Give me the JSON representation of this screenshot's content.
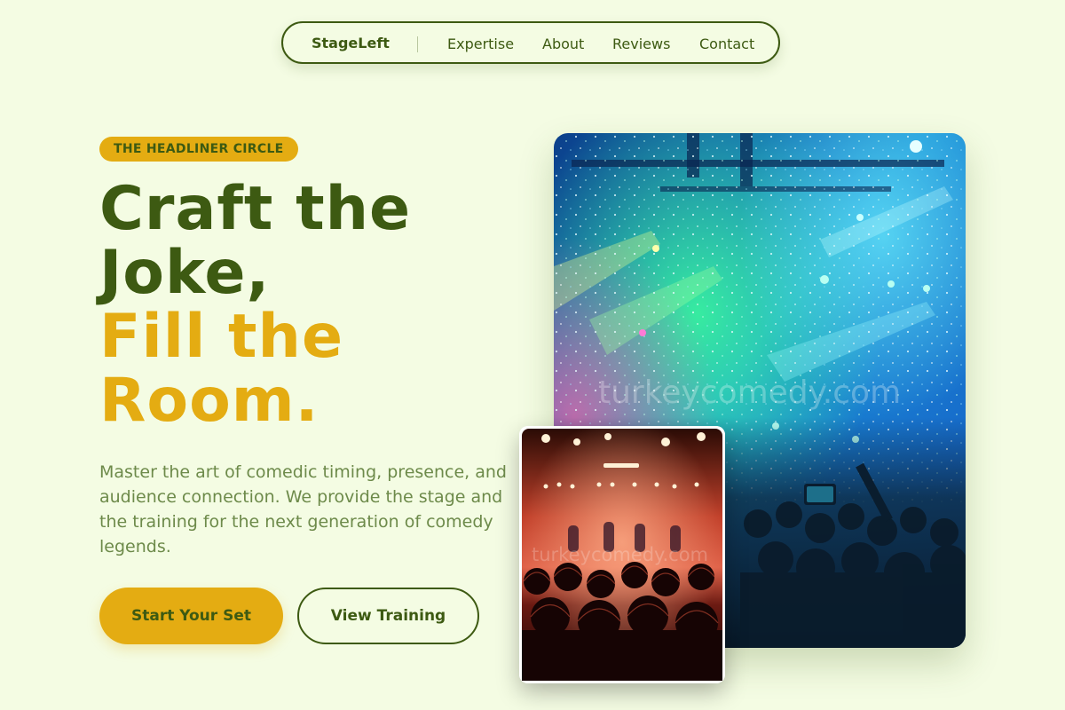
{
  "nav": {
    "brand": "StageLeft",
    "links": [
      "Expertise",
      "About",
      "Reviews",
      "Contact"
    ]
  },
  "hero": {
    "badge": "THE HEADLINER CIRCLE",
    "headline": [
      "Craft the",
      "Joke,",
      "Fill the",
      "Room."
    ],
    "description": "Master the art of comedic timing, presence, and audience connection. We provide the stage and the training for the next generation of comedy legends.",
    "primary_cta": "Start Your Set",
    "secondary_cta": "View Training"
  },
  "images": {
    "main_watermark": "turkeycomedy.com",
    "small_watermark": "turkeycomedy.com"
  },
  "colors": {
    "background": "#f4fce3",
    "primary_green": "#3d5a12",
    "accent_gold": "#e4ac12",
    "text_muted": "#6d8a4a"
  }
}
